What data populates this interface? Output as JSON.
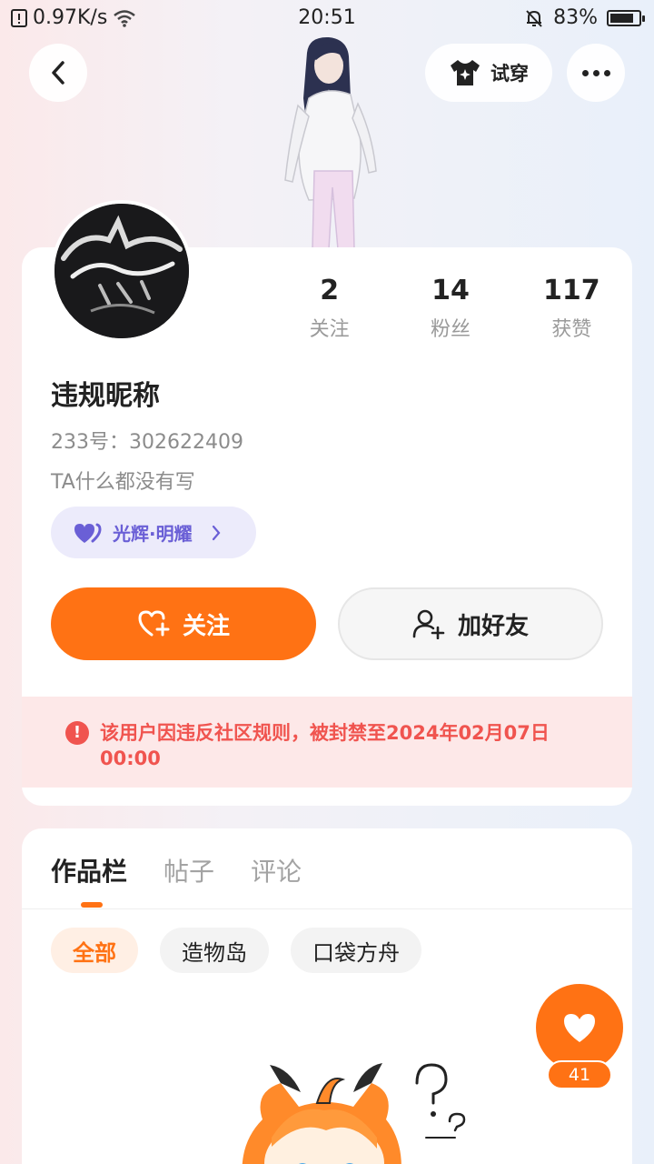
{
  "status_bar": {
    "network_speed": "0.97K/s",
    "time": "20:51",
    "battery": "83%",
    "battery_level": 0.83
  },
  "header": {
    "try_on_label": "试穿"
  },
  "profile": {
    "stats": [
      {
        "value": "2",
        "label": "关注"
      },
      {
        "value": "14",
        "label": "粉丝"
      },
      {
        "value": "117",
        "label": "获赞"
      }
    ],
    "nickname": "违规昵称",
    "uid": "233号：302622409",
    "bio": "TA什么都没有写",
    "badge_label": "光辉·明耀",
    "follow_label": "关注",
    "add_friend_label": "加好友",
    "ban_notice": "该用户因违反社区规则，被封禁至2024年02月07日 00:00"
  },
  "works": {
    "tabs": [
      {
        "label": "作品栏"
      },
      {
        "label": "帖子"
      },
      {
        "label": "评论"
      }
    ],
    "chips": [
      {
        "label": "全部"
      },
      {
        "label": "造物岛"
      },
      {
        "label": "口袋方舟"
      }
    ]
  },
  "like_fab": {
    "count": "41"
  },
  "colors": {
    "accent": "#ff7214",
    "danger": "#f0544f",
    "badge": "#6a5fd6"
  }
}
